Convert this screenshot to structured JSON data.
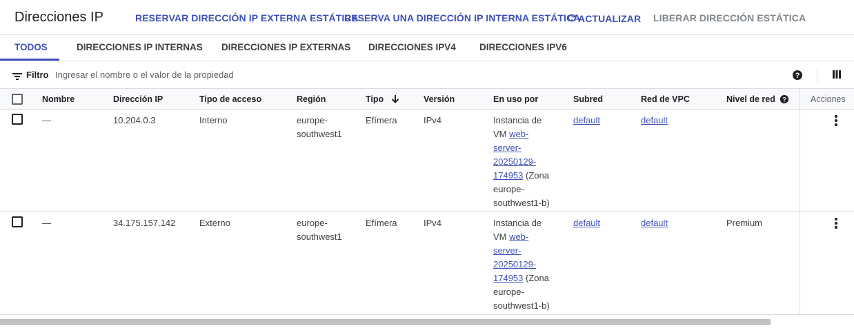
{
  "header": {
    "title": "Direcciones IP",
    "actions": {
      "reserve_external": "RESERVAR DIRECCIÓN IP EXTERNA ESTÁTICA",
      "reserve_internal": "RESERVA UNA DIRECCIÓN IP INTERNA ESTÁTICA",
      "refresh": "ACTUALIZAR",
      "release": "LIBERAR DIRECCIÓN ESTÁTICA"
    }
  },
  "tabs": [
    {
      "label": "TODOS",
      "active": true
    },
    {
      "label": "DIRECCIONES IP INTERNAS"
    },
    {
      "label": "DIRECCIONES IP EXTERNAS"
    },
    {
      "label": "DIRECCIONES IPV4"
    },
    {
      "label": "DIRECCIONES IPV6"
    }
  ],
  "filter": {
    "label": "Filtro",
    "placeholder": "Ingresar el nombre o el valor de la propiedad"
  },
  "table": {
    "columns": {
      "name": "Nombre",
      "ip": "Dirección IP",
      "access": "Tipo de acceso",
      "region": "Región",
      "type": "Tipo",
      "version": "Versión",
      "used_by": "En uso por",
      "subnet": "Subred",
      "vpc": "Red de VPC",
      "tier": "Nivel de red",
      "actions": "Acciones"
    },
    "sort": {
      "column": "Tipo",
      "direction": "descending"
    },
    "rows": [
      {
        "name": "—",
        "ip": "10.204.0.3",
        "access": "Interno",
        "region": "europe-southwest1",
        "type": "Efímera",
        "version": "IPv4",
        "used_by_prefix": "Instancia de VM",
        "used_by_link": "web-server-20250129-174953",
        "used_by_suffix": "(Zona europe-southwest1-b)",
        "subnet": "default",
        "vpc": "default",
        "tier": ""
      },
      {
        "name": "—",
        "ip": "34.175.157.142",
        "access": "Externo",
        "region": "europe-southwest1",
        "type": "Efímera",
        "version": "IPv4",
        "used_by_prefix": "Instancia de VM",
        "used_by_link": "web-server-20250129-174953",
        "used_by_suffix": "(Zona europe-southwest1-b)",
        "subnet": "default",
        "vpc": "default",
        "tier": "Premium"
      }
    ]
  },
  "colors": {
    "accent": "#3f51b5",
    "disabled": "#80868b",
    "border": "#dadce0",
    "header_bg": "#f8f9fa"
  },
  "icons": [
    "filter-icon",
    "help-icon",
    "column-display-icon",
    "refresh-icon",
    "sort-arrow-down-icon",
    "more-vert-icon"
  ]
}
